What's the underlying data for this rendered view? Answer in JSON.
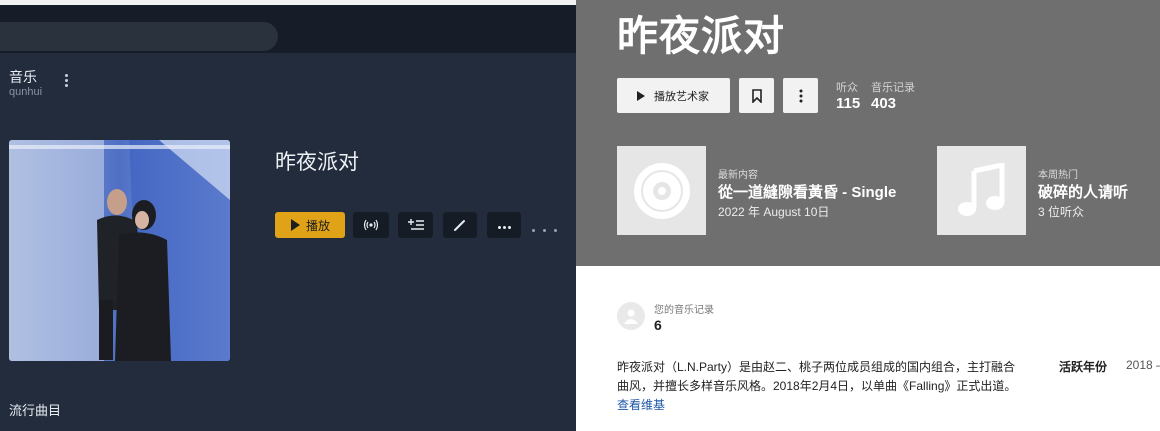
{
  "player": {
    "library_title": "音乐",
    "library_user": "qunhui",
    "album_title": "昨夜派对",
    "play_label": "播放",
    "section_heading": "流行曲目"
  },
  "artist_page": {
    "artist_name": "昨夜派对",
    "play_artist_label": "播放艺术家",
    "listeners_label": "听众",
    "listeners_value": "115",
    "scrobbles_label": "音乐记录",
    "scrobbles_value": "403",
    "latest": {
      "kicker": "最新内容",
      "title": "從一道縫隙看黃昏 - Single",
      "date": "2022 年 August 10日"
    },
    "trending": {
      "kicker": "本周热门",
      "title": "破碎的人请听",
      "listeners": "3 位听众"
    },
    "your_scrobbles_label": "您的音乐记录",
    "your_scrobbles_value": "6",
    "bio_line1": "昨夜派对（L.N.Party）是由赵二、桃子两位成员组成的国内组合，主打融合",
    "bio_line2": "曲风，并擅长多样音乐风格。2018年2月4日，以单曲《Falling》正式出道。",
    "wiki_link": "查看维基",
    "active_years_label": "活跃年份",
    "active_years_value": "2018 –"
  },
  "colors": {
    "player_bg": "#222c3c",
    "player_accent": "#e0a216",
    "hero_bg": "#6f6f6f",
    "link": "#1e57a6"
  },
  "icons": [
    "kebab-icon",
    "play-icon",
    "radio-icon",
    "add-to-queue-icon",
    "edit-icon",
    "more-icon",
    "bookmark-icon",
    "disc-icon",
    "music-note-icon",
    "user-avatar-icon"
  ]
}
